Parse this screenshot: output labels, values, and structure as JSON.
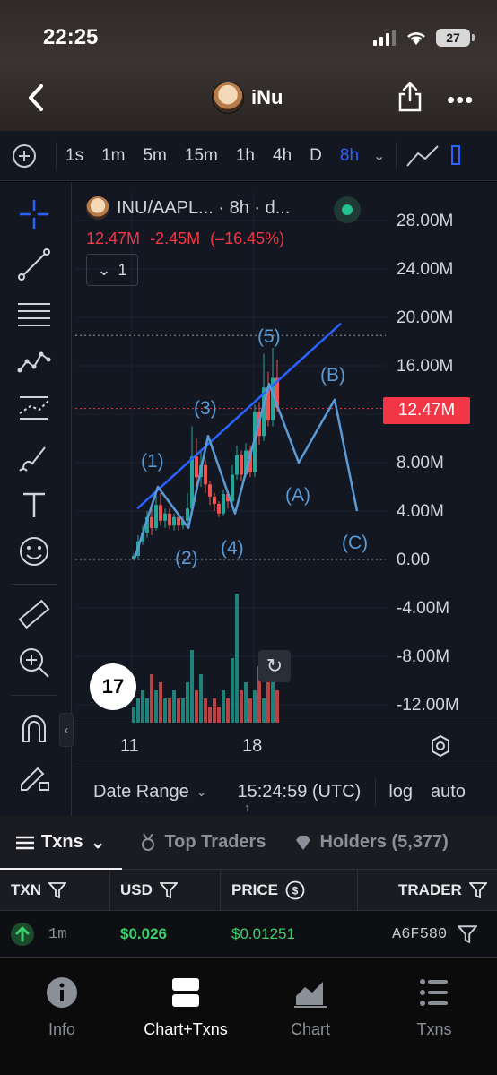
{
  "status_bar": {
    "time": "22:25",
    "battery": "27"
  },
  "header": {
    "title": "iNu"
  },
  "toolbar": {
    "intervals": [
      "1s",
      "1m",
      "5m",
      "15m",
      "1h",
      "4h",
      "D",
      "8h"
    ],
    "active_interval": "8h"
  },
  "chart": {
    "legend_title": "INU/AAPL... · 8h · d...",
    "last_value": "12.47M",
    "change": "-2.45M",
    "change_pct": "(–16.45%)",
    "collapse_count": "1",
    "current_price_tag": "12.47M",
    "tv_logo": "17",
    "date_range_label": "Date Range",
    "time_label": "15:24:59 (UTC)",
    "log_label": "log",
    "auto_label": "auto"
  },
  "chart_data": {
    "type": "candlestick",
    "ylim": [
      -13600000,
      29500000
    ],
    "y_tick_labels": [
      "28.00M",
      "24.00M",
      "20.00M",
      "16.00M",
      "8.00M",
      "4.00M",
      "0.00",
      "-4.00M",
      "-8.00M",
      "-12.00M"
    ],
    "x_tick_labels": [
      "11",
      "18"
    ],
    "candles": [
      {
        "o": 0.0,
        "c": 0.3,
        "h": 0.5,
        "l": -0.1
      },
      {
        "o": 0.3,
        "c": 1.5,
        "h": 2.0,
        "l": 0.1
      },
      {
        "o": 1.5,
        "c": 2.2,
        "h": 2.8,
        "l": 1.2
      },
      {
        "o": 2.2,
        "c": 3.5,
        "h": 4.0,
        "l": 1.8
      },
      {
        "o": 3.5,
        "c": 2.6,
        "h": 4.5,
        "l": 2.0
      },
      {
        "o": 2.6,
        "c": 4.5,
        "h": 5.5,
        "l": 2.4
      },
      {
        "o": 4.5,
        "c": 3.2,
        "h": 5.5,
        "l": 2.8
      },
      {
        "o": 3.2,
        "c": 3.8,
        "h": 4.2,
        "l": 2.6
      },
      {
        "o": 3.8,
        "c": 2.8,
        "h": 4.2,
        "l": 2.5
      },
      {
        "o": 2.8,
        "c": 3.5,
        "h": 3.8,
        "l": 2.4
      },
      {
        "o": 3.5,
        "c": 2.8,
        "h": 3.8,
        "l": 2.4
      },
      {
        "o": 2.8,
        "c": 3.2,
        "h": 3.6,
        "l": 2.5
      },
      {
        "o": 3.2,
        "c": 4.2,
        "h": 5.5,
        "l": 2.8
      },
      {
        "o": 4.2,
        "c": 8.5,
        "h": 11.0,
        "l": 4.0
      },
      {
        "o": 8.5,
        "c": 6.8,
        "h": 10.0,
        "l": 6.0
      },
      {
        "o": 6.8,
        "c": 7.8,
        "h": 9.0,
        "l": 6.0
      },
      {
        "o": 7.8,
        "c": 6.2,
        "h": 8.2,
        "l": 5.5
      },
      {
        "o": 6.2,
        "c": 5.2,
        "h": 6.5,
        "l": 4.5
      },
      {
        "o": 5.2,
        "c": 4.6,
        "h": 5.5,
        "l": 4.0
      },
      {
        "o": 4.6,
        "c": 3.8,
        "h": 4.8,
        "l": 3.5
      },
      {
        "o": 3.8,
        "c": 5.4,
        "h": 5.8,
        "l": 3.6
      },
      {
        "o": 5.4,
        "c": 4.8,
        "h": 5.8,
        "l": 4.2
      },
      {
        "o": 4.8,
        "c": 7.0,
        "h": 7.8,
        "l": 4.6
      },
      {
        "o": 7.0,
        "c": 8.6,
        "h": 9.4,
        "l": 6.6
      },
      {
        "o": 8.6,
        "c": 7.0,
        "h": 9.0,
        "l": 6.5
      },
      {
        "o": 7.0,
        "c": 9.0,
        "h": 9.6,
        "l": 6.8
      },
      {
        "o": 9.0,
        "c": 7.2,
        "h": 9.4,
        "l": 6.8
      },
      {
        "o": 7.2,
        "c": 12.2,
        "h": 12.8,
        "l": 6.8
      },
      {
        "o": 12.2,
        "c": 10.2,
        "h": 13.0,
        "l": 9.5
      },
      {
        "o": 10.2,
        "c": 14.2,
        "h": 17.0,
        "l": 9.8
      },
      {
        "o": 14.2,
        "c": 11.5,
        "h": 15.5,
        "l": 11.0
      },
      {
        "o": 11.5,
        "c": 15.0,
        "h": 17.5,
        "l": 11.0
      },
      {
        "o": 15.0,
        "c": 12.5,
        "h": 16.5,
        "l": 12.2
      }
    ],
    "volume": [
      2,
      3,
      4,
      3,
      6,
      4,
      5,
      3,
      3,
      4,
      3,
      3,
      5,
      9,
      4,
      6,
      3,
      2,
      3,
      2,
      4,
      3,
      8,
      16,
      4,
      5,
      3,
      4,
      7,
      3,
      5,
      6,
      4
    ],
    "annotations": [
      "(1)",
      "(2)",
      "(3)",
      "(4)",
      "(5)",
      "(A)",
      "(B)",
      "(C)"
    ]
  },
  "tabs": [
    {
      "label": "Txns"
    },
    {
      "label": "Top Traders"
    },
    {
      "label": "Holders (5,377)"
    }
  ],
  "table": {
    "headers": [
      "TXN",
      "USD",
      "PRICE",
      "TRADER"
    ],
    "rows": [
      {
        "age": "1m",
        "usd": "$0.026",
        "price": "$0.01251",
        "trader": "A6F580"
      }
    ]
  },
  "nav": [
    {
      "label": "Info",
      "icon": "info-icon"
    },
    {
      "label": "Chart+Txns",
      "icon": "chart-txns-icon"
    },
    {
      "label": "Chart",
      "icon": "chart-icon"
    },
    {
      "label": "Txns",
      "icon": "list-icon"
    }
  ],
  "colors": {
    "up": "#26a69a",
    "down": "#ef5350",
    "accent": "#2962ff",
    "wave": "#5b9bd5",
    "buy": "#3ccf6e"
  }
}
